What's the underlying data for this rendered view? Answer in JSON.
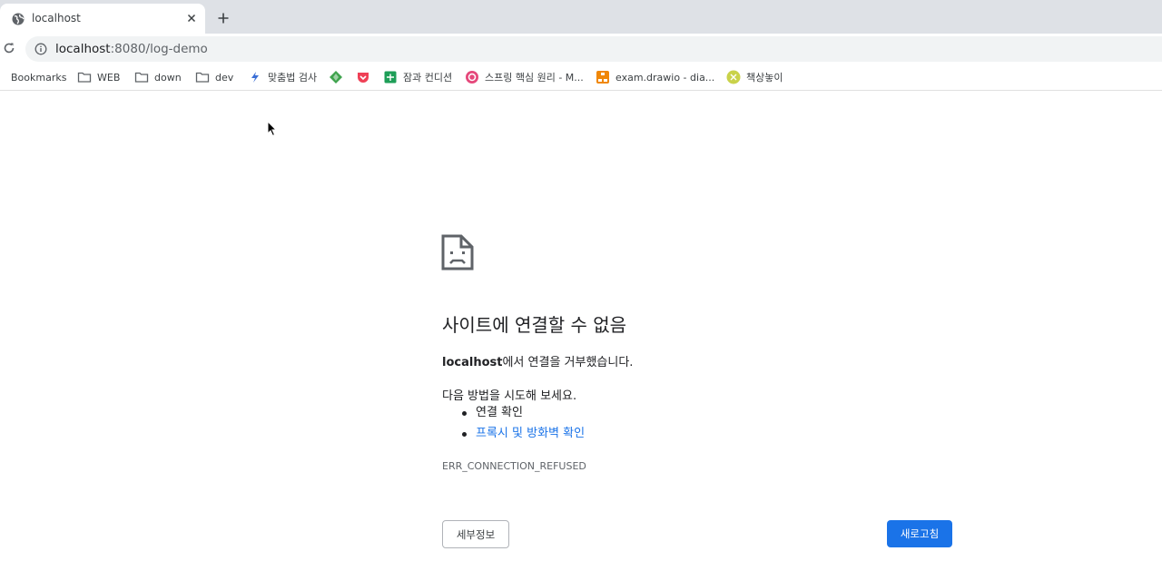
{
  "browser": {
    "tab": {
      "title": "localhost"
    },
    "address": {
      "host": "localhost",
      "path": ":8080/log-demo"
    },
    "bookmarks": [
      {
        "label": "Bookmarks",
        "icon": "bookmarks-icon"
      },
      {
        "label": "WEB",
        "icon": "folder-icon"
      },
      {
        "label": "down",
        "icon": "folder-icon"
      },
      {
        "label": "dev",
        "icon": "folder-icon"
      },
      {
        "label": "맞춤법 검사",
        "icon": "spellcheck-icon"
      },
      {
        "label": "",
        "icon": "green-diamond-icon"
      },
      {
        "label": "",
        "icon": "pocket-icon"
      },
      {
        "label": "잠과 컨디션",
        "icon": "sheets-icon"
      },
      {
        "label": "스프링 핵심 원리 - M...",
        "icon": "inflearn-icon"
      },
      {
        "label": "exam.drawio - dia...",
        "icon": "drawio-icon"
      },
      {
        "label": "책상놓이",
        "icon": "yellow-circle-icon"
      }
    ]
  },
  "error": {
    "title": "사이트에 연결할 수 없음",
    "host": "localhost",
    "host_suffix": "에서 연결을 거부했습니다.",
    "suggest_intro": "다음 방법을 시도해 보세요.",
    "suggestions": [
      {
        "label": "연결 확인",
        "is_link": false
      },
      {
        "label": "프록시 및 방화벽 확인",
        "is_link": true
      }
    ],
    "code": "ERR_CONNECTION_REFUSED",
    "details_button": "세부정보",
    "reload_button": "새로고침"
  },
  "colors": {
    "accent": "#1a73e8",
    "tabstrip": "#dee1e6",
    "omnibox": "#f1f3f4"
  }
}
